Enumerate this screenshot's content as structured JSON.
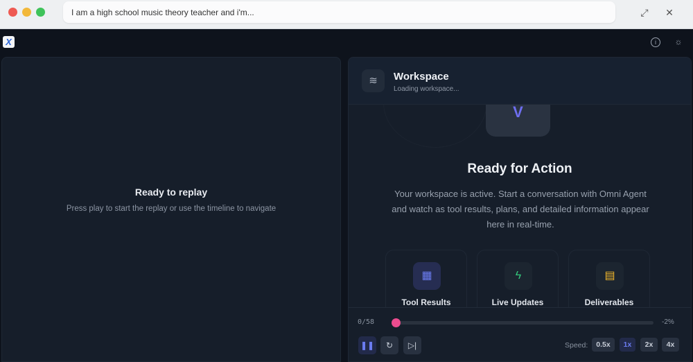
{
  "window": {
    "url_text": "I am a high school music theory teacher and i'm..."
  },
  "app": {
    "logo_text": "X"
  },
  "left_panel": {
    "title": "Ready to replay",
    "subtitle": "Press play to start the replay or use the timeline to navigate"
  },
  "workspace": {
    "title": "Workspace",
    "status": "Loading workspace...",
    "hero_glyph": "V",
    "heading": "Ready for Action",
    "description": "Your workspace is active. Start a conversation with Omni Agent and watch as tool results, plans, and detailed information appear here in real-time.",
    "cards": [
      {
        "label": "Tool Results",
        "icon": "layout-icon",
        "color": "#6b7cf0"
      },
      {
        "label": "Live Updates",
        "icon": "lightning-icon",
        "color": "#34c77b"
      },
      {
        "label": "Deliverables",
        "icon": "document-icon",
        "color": "#f1b62b"
      }
    ]
  },
  "player": {
    "counter": "0/58",
    "progress_percent": 0,
    "percent_label": "-2%",
    "speed_label": "Speed:",
    "speeds": [
      "0.5x",
      "1x",
      "2x",
      "4x"
    ],
    "active_speed": "1x"
  },
  "colors": {
    "accent": "#ec4c8f",
    "active": "#6b7cf0"
  }
}
